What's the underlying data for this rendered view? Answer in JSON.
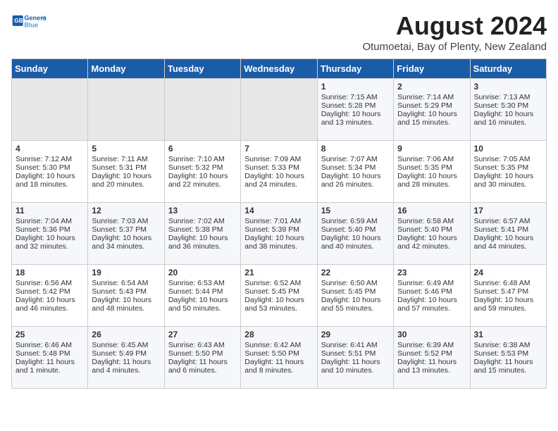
{
  "logo": {
    "line1": "General",
    "line2": "Blue"
  },
  "title": "August 2024",
  "subtitle": "Otumoetai, Bay of Plenty, New Zealand",
  "days_of_week": [
    "Sunday",
    "Monday",
    "Tuesday",
    "Wednesday",
    "Thursday",
    "Friday",
    "Saturday"
  ],
  "weeks": [
    [
      {
        "day": "",
        "empty": true
      },
      {
        "day": "",
        "empty": true
      },
      {
        "day": "",
        "empty": true
      },
      {
        "day": "",
        "empty": true
      },
      {
        "day": "1",
        "lines": [
          "Sunrise: 7:15 AM",
          "Sunset: 5:28 PM",
          "Daylight: 10 hours",
          "and 13 minutes."
        ]
      },
      {
        "day": "2",
        "lines": [
          "Sunrise: 7:14 AM",
          "Sunset: 5:29 PM",
          "Daylight: 10 hours",
          "and 15 minutes."
        ]
      },
      {
        "day": "3",
        "lines": [
          "Sunrise: 7:13 AM",
          "Sunset: 5:30 PM",
          "Daylight: 10 hours",
          "and 16 minutes."
        ]
      }
    ],
    [
      {
        "day": "4",
        "lines": [
          "Sunrise: 7:12 AM",
          "Sunset: 5:30 PM",
          "Daylight: 10 hours",
          "and 18 minutes."
        ]
      },
      {
        "day": "5",
        "lines": [
          "Sunrise: 7:11 AM",
          "Sunset: 5:31 PM",
          "Daylight: 10 hours",
          "and 20 minutes."
        ]
      },
      {
        "day": "6",
        "lines": [
          "Sunrise: 7:10 AM",
          "Sunset: 5:32 PM",
          "Daylight: 10 hours",
          "and 22 minutes."
        ]
      },
      {
        "day": "7",
        "lines": [
          "Sunrise: 7:09 AM",
          "Sunset: 5:33 PM",
          "Daylight: 10 hours",
          "and 24 minutes."
        ]
      },
      {
        "day": "8",
        "lines": [
          "Sunrise: 7:07 AM",
          "Sunset: 5:34 PM",
          "Daylight: 10 hours",
          "and 26 minutes."
        ]
      },
      {
        "day": "9",
        "lines": [
          "Sunrise: 7:06 AM",
          "Sunset: 5:35 PM",
          "Daylight: 10 hours",
          "and 28 minutes."
        ]
      },
      {
        "day": "10",
        "lines": [
          "Sunrise: 7:05 AM",
          "Sunset: 5:35 PM",
          "Daylight: 10 hours",
          "and 30 minutes."
        ]
      }
    ],
    [
      {
        "day": "11",
        "lines": [
          "Sunrise: 7:04 AM",
          "Sunset: 5:36 PM",
          "Daylight: 10 hours",
          "and 32 minutes."
        ]
      },
      {
        "day": "12",
        "lines": [
          "Sunrise: 7:03 AM",
          "Sunset: 5:37 PM",
          "Daylight: 10 hours",
          "and 34 minutes."
        ]
      },
      {
        "day": "13",
        "lines": [
          "Sunrise: 7:02 AM",
          "Sunset: 5:38 PM",
          "Daylight: 10 hours",
          "and 36 minutes."
        ]
      },
      {
        "day": "14",
        "lines": [
          "Sunrise: 7:01 AM",
          "Sunset: 5:39 PM",
          "Daylight: 10 hours",
          "and 38 minutes."
        ]
      },
      {
        "day": "15",
        "lines": [
          "Sunrise: 6:59 AM",
          "Sunset: 5:40 PM",
          "Daylight: 10 hours",
          "and 40 minutes."
        ]
      },
      {
        "day": "16",
        "lines": [
          "Sunrise: 6:58 AM",
          "Sunset: 5:40 PM",
          "Daylight: 10 hours",
          "and 42 minutes."
        ]
      },
      {
        "day": "17",
        "lines": [
          "Sunrise: 6:57 AM",
          "Sunset: 5:41 PM",
          "Daylight: 10 hours",
          "and 44 minutes."
        ]
      }
    ],
    [
      {
        "day": "18",
        "lines": [
          "Sunrise: 6:56 AM",
          "Sunset: 5:42 PM",
          "Daylight: 10 hours",
          "and 46 minutes."
        ]
      },
      {
        "day": "19",
        "lines": [
          "Sunrise: 6:54 AM",
          "Sunset: 5:43 PM",
          "Daylight: 10 hours",
          "and 48 minutes."
        ]
      },
      {
        "day": "20",
        "lines": [
          "Sunrise: 6:53 AM",
          "Sunset: 5:44 PM",
          "Daylight: 10 hours",
          "and 50 minutes."
        ]
      },
      {
        "day": "21",
        "lines": [
          "Sunrise: 6:52 AM",
          "Sunset: 5:45 PM",
          "Daylight: 10 hours",
          "and 53 minutes."
        ]
      },
      {
        "day": "22",
        "lines": [
          "Sunrise: 6:50 AM",
          "Sunset: 5:45 PM",
          "Daylight: 10 hours",
          "and 55 minutes."
        ]
      },
      {
        "day": "23",
        "lines": [
          "Sunrise: 6:49 AM",
          "Sunset: 5:46 PM",
          "Daylight: 10 hours",
          "and 57 minutes."
        ]
      },
      {
        "day": "24",
        "lines": [
          "Sunrise: 6:48 AM",
          "Sunset: 5:47 PM",
          "Daylight: 10 hours",
          "and 59 minutes."
        ]
      }
    ],
    [
      {
        "day": "25",
        "lines": [
          "Sunrise: 6:46 AM",
          "Sunset: 5:48 PM",
          "Daylight: 11 hours",
          "and 1 minute."
        ]
      },
      {
        "day": "26",
        "lines": [
          "Sunrise: 6:45 AM",
          "Sunset: 5:49 PM",
          "Daylight: 11 hours",
          "and 4 minutes."
        ]
      },
      {
        "day": "27",
        "lines": [
          "Sunrise: 6:43 AM",
          "Sunset: 5:50 PM",
          "Daylight: 11 hours",
          "and 6 minutes."
        ]
      },
      {
        "day": "28",
        "lines": [
          "Sunrise: 6:42 AM",
          "Sunset: 5:50 PM",
          "Daylight: 11 hours",
          "and 8 minutes."
        ]
      },
      {
        "day": "29",
        "lines": [
          "Sunrise: 6:41 AM",
          "Sunset: 5:51 PM",
          "Daylight: 11 hours",
          "and 10 minutes."
        ]
      },
      {
        "day": "30",
        "lines": [
          "Sunrise: 6:39 AM",
          "Sunset: 5:52 PM",
          "Daylight: 11 hours",
          "and 13 minutes."
        ]
      },
      {
        "day": "31",
        "lines": [
          "Sunrise: 6:38 AM",
          "Sunset: 5:53 PM",
          "Daylight: 11 hours",
          "and 15 minutes."
        ]
      }
    ]
  ]
}
